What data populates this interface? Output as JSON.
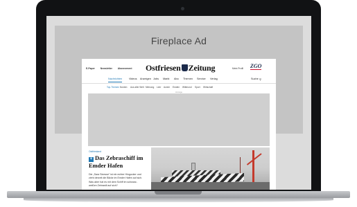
{
  "fireplace_ad": {
    "label": "Fireplace Ad"
  },
  "site": {
    "top_links": [
      "E-Paper",
      "Newsletter",
      "Abonnement"
    ],
    "logo_left": "Ostfriesen",
    "logo_right": "Zeitung",
    "account": "Mein Profil",
    "partner_logo": "ZGO",
    "nav": {
      "items": [
        "Nachrichten",
        "Videos",
        "Anzeigen",
        "Jobs",
        "Markt",
        "Abo",
        "Themen",
        "Service",
        "Verlag"
      ],
      "active": "Nachrichten",
      "search_label": "Suche"
    },
    "subnav": {
      "items": [
        "Top-Themen",
        "Norden",
        "Aus aller Welt",
        "Meinung",
        "Leer",
        "Aurich",
        "Emden",
        "Wittmund",
        "Sport",
        "Wirtschaft"
      ],
      "active": "Top-Themen"
    },
    "ad_label": "Anzeige",
    "article": {
      "kicker": "Ostfriesland",
      "plus_icon": "+",
      "headline": "Das Zebraschiff im Emder Hafen",
      "teaser": "Die „Sara Sinesse“ ist ein echter Hingucker und zieht derzeit die Blicke im Emder Hafen auf sich. Was aber hat es mit dem Schiff im schwarz-weißen Zebrastil auf sich?"
    }
  },
  "colors": {
    "accent": "#1f78b4",
    "ad_gray": "#c4c4c4",
    "frame": "#111214"
  }
}
